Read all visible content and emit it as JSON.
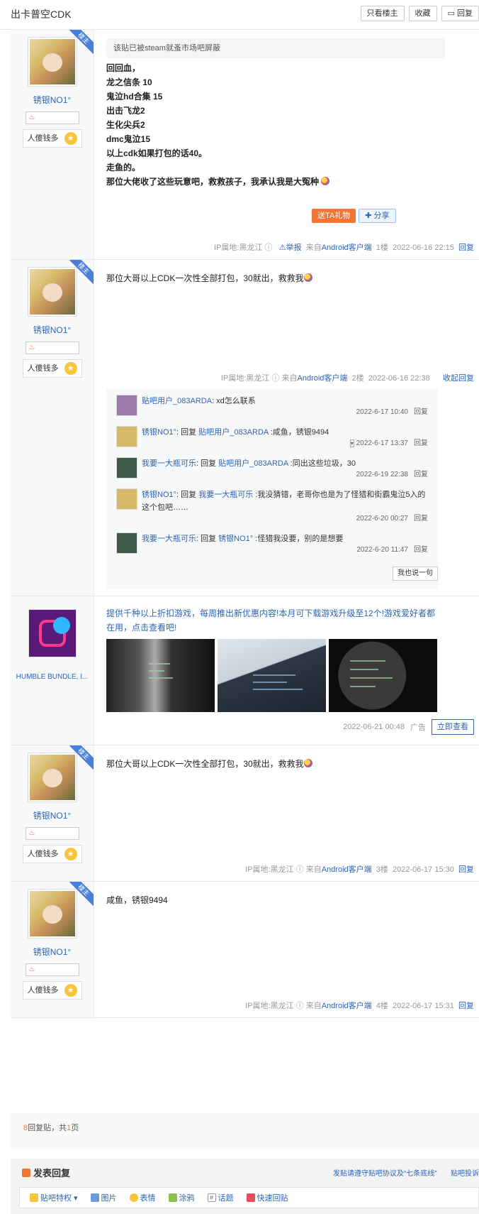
{
  "header": {
    "title": "出卡普空CDK",
    "buttons": [
      "只看楼主",
      "收藏",
      "回复"
    ]
  },
  "user": {
    "name": "锈银NO1°",
    "ribbon": "楼主",
    "tag": "人傻钱多"
  },
  "post1": {
    "notice": "该贴已被steam就蚤市场吧屏蔽",
    "lines": [
      "回回血，",
      "龙之信条 10",
      "鬼泣hd合集 15",
      "出击飞龙2",
      "生化尖兵2",
      "dmc鬼泣15",
      "以上cdk如果打包的话40。",
      "走鱼的。",
      "那位大佬收了这些玩意吧，救救孩子，我承认我是大冤种"
    ],
    "gift": "送TA礼物",
    "share": "分享",
    "ip": "IP属地:黑龙江",
    "report": "举报",
    "from": "来自",
    "client": "Android客户端",
    "floor": "1楼",
    "time": "2022-06-16 22:15",
    "reply": "回复"
  },
  "post2": {
    "text": "那位大哥以上CDK一次性全部打包，30就出，救救我",
    "ip": "IP属地:黑龙江",
    "from": "来自",
    "client": "Android客户端",
    "floor": "2楼",
    "time": "2022-06-16 22:38",
    "collapse": "收起回复",
    "comments": [
      {
        "user": "贴吧用户_083ARDA",
        "pre": ":",
        "mid": "",
        "target": "",
        "text": " xd怎么联系",
        "time": "2022-6-17 10:40",
        "reply": "回复"
      },
      {
        "user": "锈银NO1°",
        "pre": ": 回复 ",
        "target": "贴吧用户_083ARDA",
        "text": " :咸鱼，锈银9494",
        "time": "2022-6-17 13:37",
        "reply": "回复"
      },
      {
        "user": "我要一大瓶可乐",
        "pre": ": 回复 ",
        "target": "贴吧用户_083ARDA",
        "text": " :同出这些垃圾，30",
        "time": "2022-6-19 22:38",
        "reply": "回复"
      },
      {
        "user": "锈银NO1°",
        "pre": ": 回复 ",
        "target": "我要一大瓶可乐",
        "text": " :我没猜错，老哥你也是为了怪猎和街霸鬼泣5入的这个包吧……",
        "time": "2022-6-20 00:27",
        "reply": "回复"
      },
      {
        "user": "我要一大瓶可乐",
        "pre": ": 回复 ",
        "target": "锈银NO1°",
        "text": " :怪猎我没要，别的是想要",
        "time": "2022-6-20 11:47",
        "reply": "回复"
      }
    ],
    "say": "我也说一句"
  },
  "ad": {
    "name": "HUMBLE BUNDLE, I...",
    "text": "提供千种以上折扣游戏，每周推出新优惠内容!本月可下载游戏升级至12个!游戏爱好者都在用，点击查看吧!",
    "time": "2022-06-21 00:48",
    "label": "广告",
    "button": "立即查看"
  },
  "post3": {
    "text": "那位大哥以上CDK一次性全部打包，30就出，救救我",
    "ip": "IP属地:黑龙江",
    "from": "来自",
    "client": "Android客户端",
    "floor": "3楼",
    "time": "2022-06-17 15:30",
    "reply": "回复"
  },
  "post4": {
    "text": "咸鱼，锈银9494",
    "ip": "IP属地:黑龙江",
    "from": "来自",
    "client": "Android客户端",
    "floor": "4楼",
    "time": "2022-06-17 15:31",
    "reply": "回复"
  },
  "pager": {
    "count": "8",
    "mid": "回复贴，共",
    "pages": "1",
    "suffix": "页"
  },
  "reply_box": {
    "title": "发表回复",
    "note": "发贴请遵守贴吧协议及“七条底线”",
    "note2": "贴吧投诉",
    "tools": [
      "贴吧特权",
      "图片",
      "表情",
      "涂鸦",
      "话题",
      "快速回贴"
    ]
  }
}
